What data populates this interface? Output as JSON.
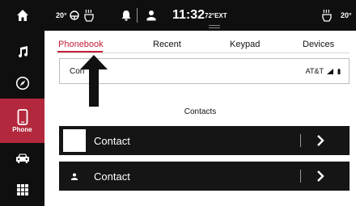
{
  "sidebar": {
    "items": [
      {
        "icon": "home-icon"
      },
      {
        "icon": "music-note-icon"
      },
      {
        "icon": "compass-icon"
      },
      {
        "icon": "phone-icon",
        "label": "Phone",
        "active": true
      },
      {
        "icon": "car-icon"
      },
      {
        "icon": "apps-grid-icon"
      }
    ]
  },
  "statusbar": {
    "left_temp": "20°",
    "alert_icon": "bell-icon",
    "profile_icon": "user-icon",
    "time": "11:32",
    "outside_temp": "72°EXT",
    "right_temp": "20°"
  },
  "tabs": [
    {
      "label": "Phonebook",
      "active": true
    },
    {
      "label": "Recent"
    },
    {
      "label": "Keypad"
    },
    {
      "label": "Devices"
    }
  ],
  "carrier": {
    "left_text": "Con",
    "name": "AT&T"
  },
  "contacts": {
    "title": "Contacts",
    "rows": [
      {
        "label": "Contact",
        "avatar": "blank"
      },
      {
        "label": "Contact",
        "avatar": "person-icon"
      }
    ]
  },
  "colors": {
    "accent": "#c4203a",
    "sidebar_active": "#b3283c",
    "bar_bg": "#0f0f0f",
    "row_bg": "#151515"
  }
}
